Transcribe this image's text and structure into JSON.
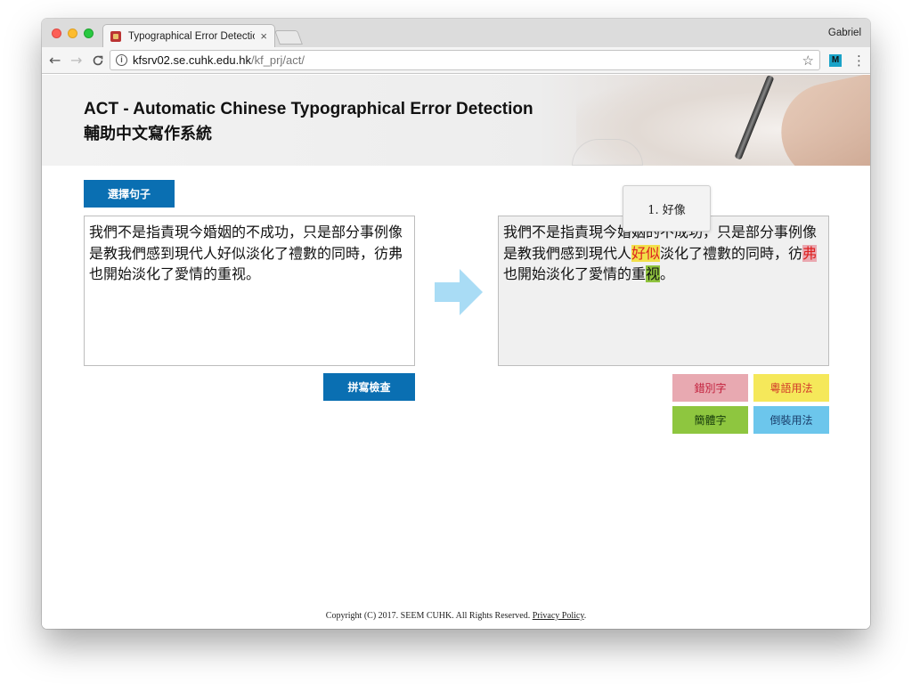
{
  "browser": {
    "tab_title": "Typographical Error Detection",
    "tab_close": "×",
    "profile": "Gabriel",
    "url_host": "kfsrv02.se.cuhk.edu.hk",
    "url_path": "/kf_prj/act/",
    "nav_back": "←",
    "nav_forward": "→",
    "nav_reload": "C",
    "star": "☆",
    "ext": "M",
    "menu": "⋮",
    "info": "i"
  },
  "header": {
    "title_en": "ACT - Automatic Chinese Typographical Error Detection",
    "title_zh": "輔助中文寫作系統"
  },
  "input": {
    "select_label": "選擇句子",
    "text": "我們不是指責現今婚姻的不成功，只是部分事例像是教我們感到現代人好似淡化了禮數的同時，彷弗也開始淡化了愛情的重视。",
    "check_label": "拼寫檢查"
  },
  "output": {
    "seg1": "我們不是指責現今婚姻的不成功，只是部分事例像是教我們感到現代人",
    "hl1": "好似",
    "seg2": "淡化了禮數的同時，彷",
    "hl2": "弗",
    "seg3": "也開始淡化了愛情的重",
    "hl3": "视",
    "seg4": "。",
    "tooltip": "1. 好像"
  },
  "legend": {
    "wrong_char": "錯別字",
    "cantonese": "粵語用法",
    "simplified": "簡體字",
    "inversion": "倒裝用法"
  },
  "footer": {
    "copyright": "Copyright (C) 2017. SEEM CUHK. All Rights Reserved.",
    "privacy": "Privacy Policy",
    "period": "."
  },
  "colors": {
    "primary_button": "#0a6fb2",
    "wrong_char": "#e8a9b1",
    "cantonese": "#f5e85a",
    "simplified": "#8ec63f",
    "inversion": "#6cc6ec",
    "arrow": "#a9dcf5"
  }
}
